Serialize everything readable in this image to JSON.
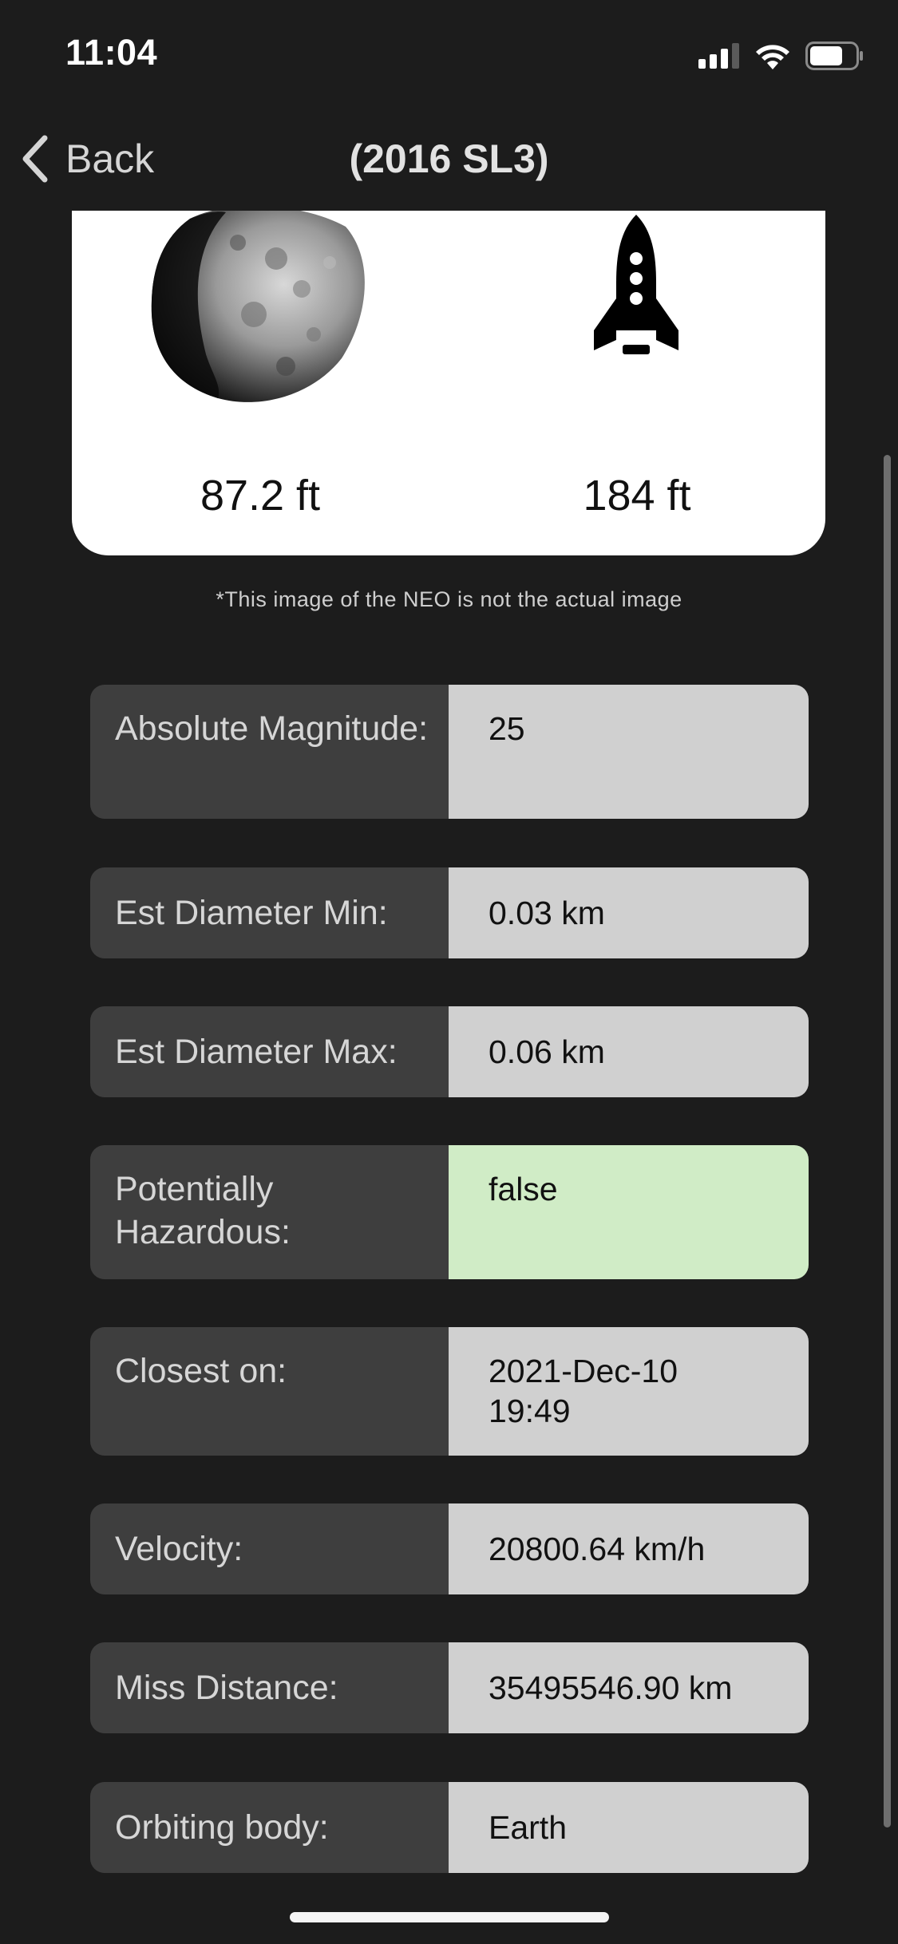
{
  "status": {
    "time": "11:04"
  },
  "nav": {
    "back_label": "Back",
    "title": "(2016 SL3)"
  },
  "comparison": {
    "neo_size": "87.2 ft",
    "reference_size": "184 ft",
    "neo_icon": "asteroid-image",
    "reference_icon": "rocket-icon",
    "disclaimer": "*This image of the NEO is not the actual image"
  },
  "details": [
    {
      "label": "Absolute Magnitude:",
      "value": "25"
    },
    {
      "label": "Est Diameter Min:",
      "value": "0.03 km"
    },
    {
      "label": "Est Diameter Max:",
      "value": "0.06 km"
    },
    {
      "label": "Potentially Hazardous:",
      "value": "false",
      "highlight": "#d0ecc6"
    },
    {
      "label": "Closest on:",
      "value": "2021-Dec-10 19:49"
    },
    {
      "label": "Velocity:",
      "value": "20800.64 km/h"
    },
    {
      "label": "Miss Distance:",
      "value": "35495546.90 km"
    },
    {
      "label": "Orbiting body:",
      "value": "Earth"
    }
  ]
}
